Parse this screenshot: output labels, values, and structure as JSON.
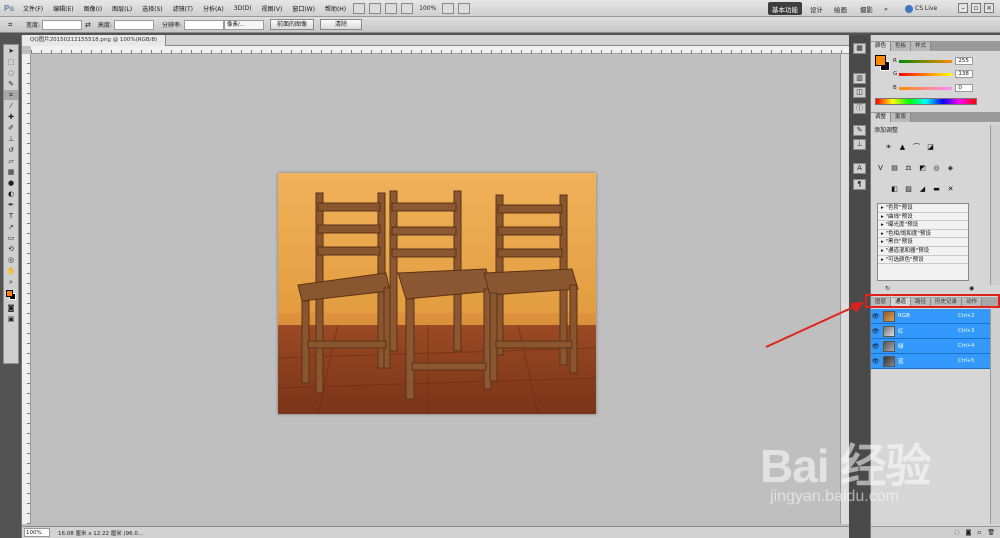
{
  "app": {
    "logo": "Ps",
    "menus": [
      "文件(F)",
      "编辑(E)",
      "图像(I)",
      "图层(L)",
      "选择(S)",
      "滤镜(T)",
      "分析(A)",
      "3D(D)",
      "视图(V)",
      "窗口(W)",
      "帮助(H)"
    ],
    "zoom": "100%",
    "workspaces": [
      "基本功能",
      "设计",
      "绘画",
      "摄影"
    ],
    "active_workspace": "基本功能",
    "more": "»",
    "cslive": "CS Live"
  },
  "options_bar": {
    "width_label": "宽度:",
    "height_label": "高度:",
    "resolution_label": "分辨率:",
    "unit_select": "像素/...",
    "front_image_button": "前面的图像",
    "clear_button": "清除"
  },
  "document": {
    "tab_title": "QQ图片20150212155518.png @ 100%(RGB/8)",
    "status_zoom": "100%",
    "status_info": "16.08 厘米 x 12.22 厘米 (96.0..."
  },
  "panels": {
    "color_tabs": [
      "颜色",
      "色板",
      "样式"
    ],
    "color": {
      "r_label": "R",
      "r_value": "255",
      "g_label": "G",
      "g_value": "138",
      "b_label": "B",
      "b_value": "0",
      "foreground": "#ff8a00"
    },
    "adjust_tabs": [
      "调整",
      "蒙版"
    ],
    "adjust_title": "添加调整",
    "presets": [
      "\"色阶\"预设",
      "\"曲线\"预设",
      "\"曝光度\"预设",
      "\"色相/饱和度\"预设",
      "\"黑白\"预设",
      "\"通道混和器\"预设",
      "\"可选颜色\"预设"
    ],
    "layer_tabs": [
      "图层",
      "通道",
      "路径",
      "历史记录",
      "动作"
    ],
    "active_layer_tab": "通道",
    "channels": [
      {
        "name": "RGB",
        "shortcut": "Ctrl+2"
      },
      {
        "name": "红",
        "shortcut": "Ctrl+3"
      },
      {
        "name": "绿",
        "shortcut": "Ctrl+4"
      },
      {
        "name": "蓝",
        "shortcut": "Ctrl+5"
      }
    ]
  },
  "watermark": {
    "logo_text": "Bai  经验",
    "url": "jingyan.baidu.com"
  },
  "colors": {
    "selection_blue": "#3399ff",
    "annotation_red": "#e0201b",
    "canvas_gray": "#bfbfbf"
  }
}
